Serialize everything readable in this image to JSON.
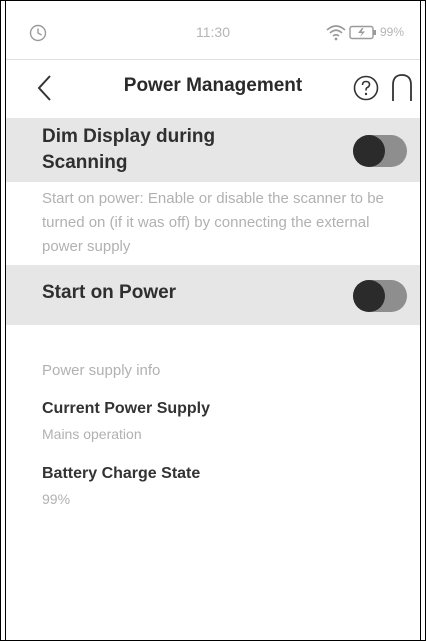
{
  "status_bar": {
    "time": "11:30",
    "battery_percent": "99%",
    "icons": [
      "clock-icon",
      "wifi-icon",
      "battery-charging-icon"
    ]
  },
  "header": {
    "title": "Power Management",
    "icons": [
      "back-icon",
      "help-icon",
      "home-icon"
    ]
  },
  "settings": [
    {
      "label": "Dim Display during Scanning",
      "toggle_on": false
    },
    {
      "label": "Start on Power",
      "toggle_on": false
    }
  ],
  "description": "Start on power: Enable or disable the scanner to be turned on (if it was off) by connecting the external power supply",
  "power_info": {
    "section_title": "Power supply info",
    "items": [
      {
        "label": "Current Power Supply",
        "value": "Mains operation"
      },
      {
        "label": "Battery Charge State",
        "value": "99%"
      }
    ]
  },
  "colors": {
    "row_background": "#e6e6e6",
    "toggle_track": "#8e8e8e",
    "toggle_knob": "#2b2b2b",
    "muted_text": "#b1b1b1"
  }
}
